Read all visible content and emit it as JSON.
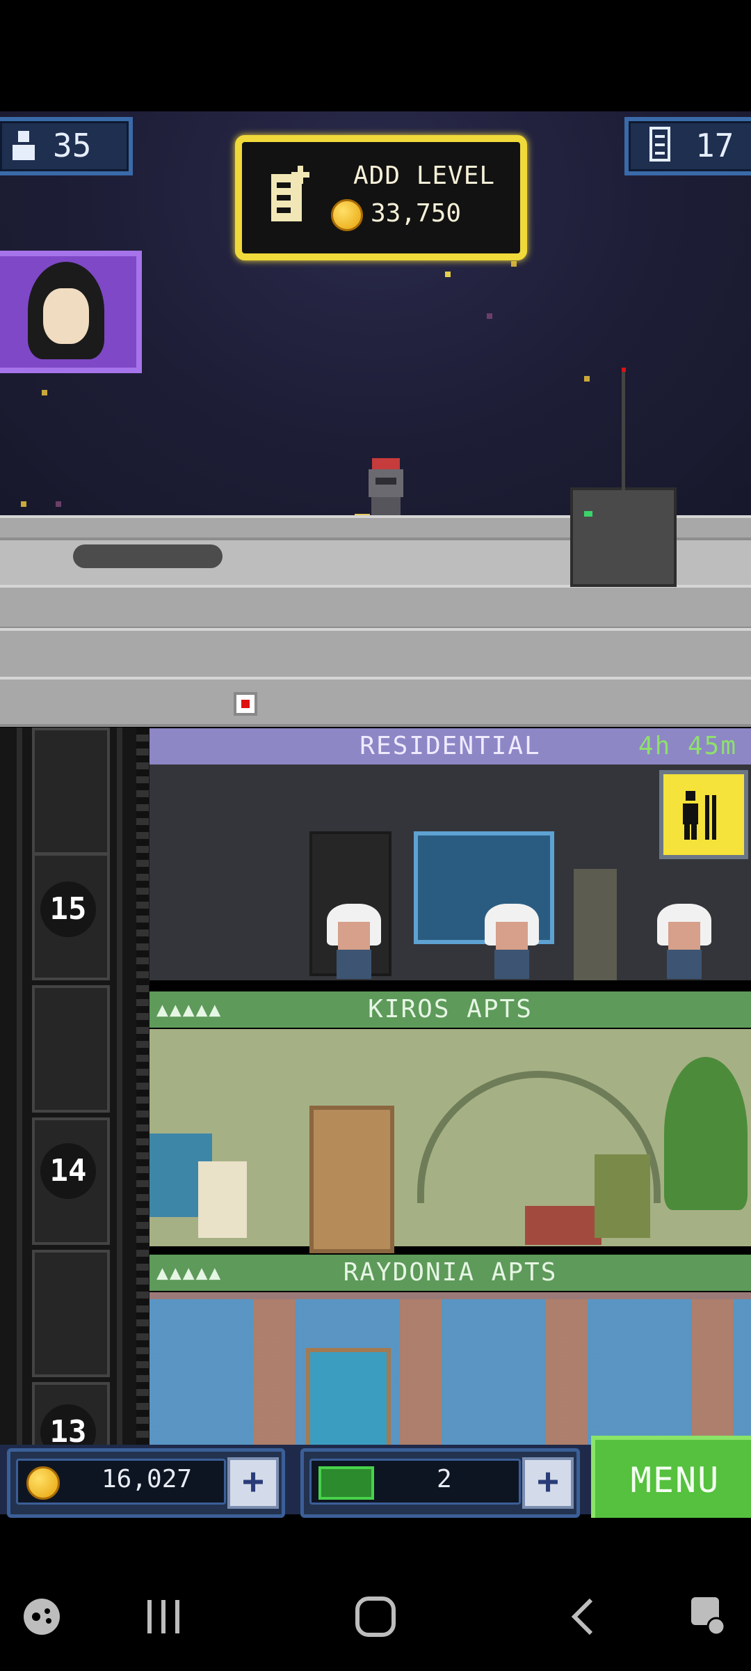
{
  "hud": {
    "population": "35",
    "floors": "17"
  },
  "add_level": {
    "label": "ADD LEVEL",
    "cost": "33,750"
  },
  "elevator": {
    "floors": [
      "15",
      "14",
      "13"
    ]
  },
  "floors": [
    {
      "name": "RESIDENTIAL",
      "timer": "4h 45m"
    },
    {
      "name": "KIROS APTS",
      "stars": "▲▲▲▲▲"
    },
    {
      "name": "RAYDONIA APTS",
      "stars": "▲▲▲▲▲"
    }
  ],
  "bottom": {
    "coins": "16,027",
    "bux": "2",
    "menu_label": "MENU"
  },
  "colors": {
    "accent_gold": "#f0d93a",
    "residential_header": "#8d87c6",
    "apts_header": "#5e9a5a",
    "menu_green": "#55c13e"
  },
  "icons": [
    "person-icon",
    "floors-icon",
    "add-floor-icon",
    "coin-icon",
    "bux-icon",
    "plus-icon",
    "elevator-call-icon",
    "game-launcher-icon",
    "recent-apps-icon",
    "home-icon",
    "back-icon",
    "screen-pin-icon"
  ]
}
